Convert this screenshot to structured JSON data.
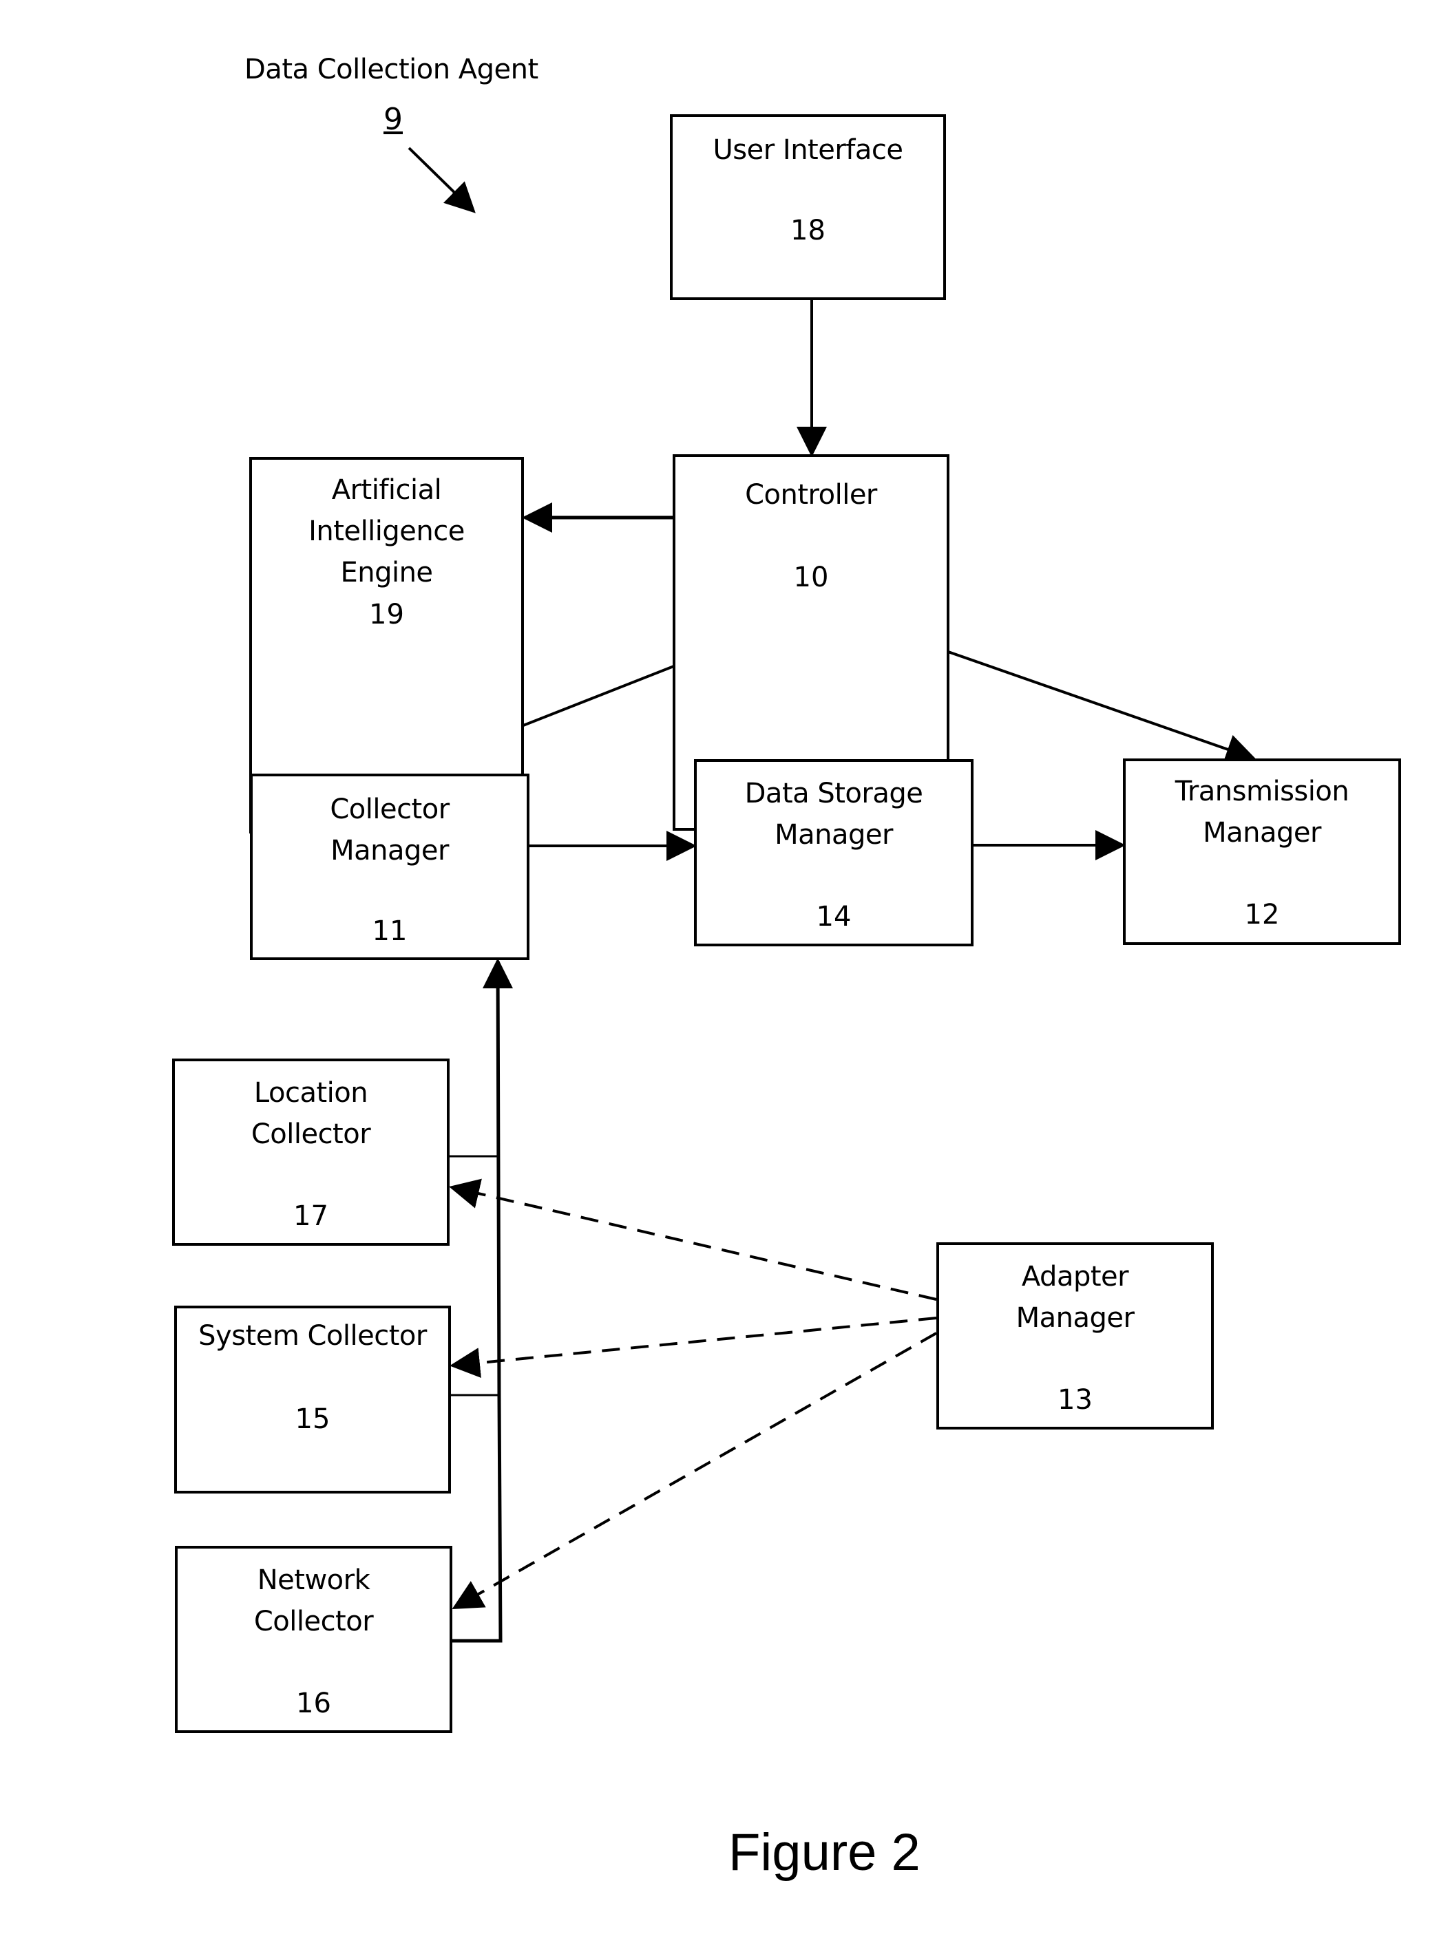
{
  "agent": {
    "title": "Data Collection Agent",
    "ref": "9"
  },
  "boxes": {
    "user_interface": {
      "label": "User Interface",
      "ref": "18"
    },
    "controller": {
      "label": "Controller",
      "ref": "10"
    },
    "ai_engine": {
      "label": "Artificial\nIntelligence\nEngine",
      "ref": "19"
    },
    "collector_manager": {
      "label": "Collector\nManager",
      "ref": "11"
    },
    "data_storage_manager": {
      "label": "Data Storage\nManager",
      "ref": "14"
    },
    "transmission_manager": {
      "label": "Transmission\nManager",
      "ref": "12"
    },
    "location_collector": {
      "label": "Location\nCollector",
      "ref": "17"
    },
    "system_collector": {
      "label": "System Collector",
      "ref": "15"
    },
    "network_collector": {
      "label": "Network\nCollector",
      "ref": "16"
    },
    "adapter_manager": {
      "label": "Adapter\nManager",
      "ref": "13"
    }
  },
  "connections": [
    {
      "from": "User Interface",
      "to": "Controller",
      "style": "solid"
    },
    {
      "from": "Controller",
      "to": "Artificial Intelligence Engine",
      "style": "solid"
    },
    {
      "from": "Controller",
      "to": "Collector Manager",
      "style": "solid"
    },
    {
      "from": "Controller",
      "to": "Data Storage Manager",
      "style": "solid"
    },
    {
      "from": "Controller",
      "to": "Transmission Manager",
      "style": "solid"
    },
    {
      "from": "Collector Manager",
      "to": "Artificial Intelligence Engine",
      "style": "solid"
    },
    {
      "from": "Collector Manager",
      "to": "Data Storage Manager",
      "style": "solid"
    },
    {
      "from": "Data Storage Manager",
      "to": "Transmission Manager",
      "style": "solid"
    },
    {
      "from": "Location Collector",
      "to": "Collector Manager",
      "style": "solid"
    },
    {
      "from": "System Collector",
      "to": "Collector Manager",
      "style": "solid"
    },
    {
      "from": "Network Collector",
      "to": "Collector Manager",
      "style": "solid"
    },
    {
      "from": "Adapter Manager",
      "to": "Location Collector",
      "style": "dashed"
    },
    {
      "from": "Adapter Manager",
      "to": "System Collector",
      "style": "dashed"
    },
    {
      "from": "Adapter Manager",
      "to": "Network Collector",
      "style": "dashed"
    }
  ],
  "caption": "Figure 2"
}
